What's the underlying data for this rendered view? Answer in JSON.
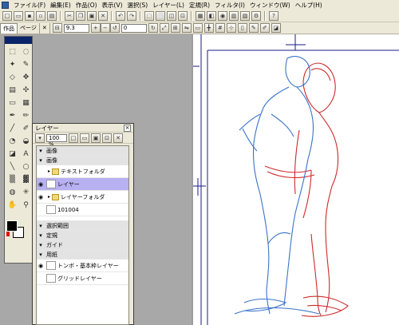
{
  "menubar": {
    "items": [
      "ファイル(F)",
      "編集(E)",
      "作品(O)",
      "表示(V)",
      "選択(S)",
      "レイヤー(L)",
      "定規(R)",
      "フィルタ(I)",
      "ウィンドウ(W)",
      "ヘルプ(H)"
    ]
  },
  "toolbar2": {
    "tab_work": "作品",
    "tab_page": "ページ",
    "zoom_value": "9.3",
    "rotate_value": "0"
  },
  "layer_panel": {
    "title": "レイヤー",
    "opacity": "100 %",
    "rows": {
      "group_manuscript": "画像",
      "group_image": "画像",
      "text_folder": "テキストフォルダ",
      "layer_selected": "レイヤー",
      "layer_folder": "レイヤーフォルダ",
      "layer_101004": "101004",
      "selection_range": "選択範囲",
      "ruler": "定規",
      "guide": "ガイド",
      "paper": "用紙",
      "tonbo_layer": "トンボ・基本枠レイヤー",
      "grid_layer": "グリッドレイヤー"
    }
  },
  "canvas": {
    "blue_line": "#3b73c8",
    "red_line": "#cc2a2a"
  }
}
